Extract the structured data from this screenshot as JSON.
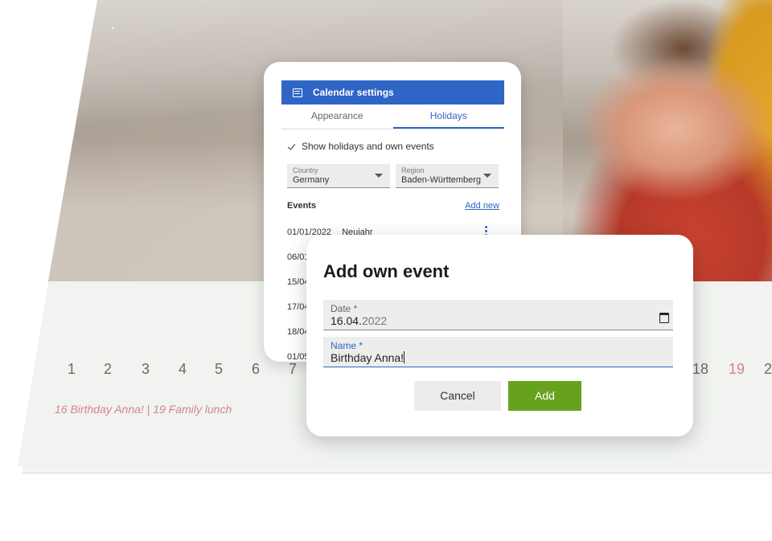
{
  "calendar": {
    "days": [
      {
        "label": "1"
      },
      {
        "label": "2"
      },
      {
        "label": "3"
      },
      {
        "label": "4"
      },
      {
        "label": "5"
      },
      {
        "label": "6"
      },
      {
        "label": "7"
      },
      {
        "label": "18"
      },
      {
        "label": "19",
        "highlight": true
      },
      {
        "label": "2"
      }
    ],
    "event_line": "16  Birthday Anna! | 19  Family lunch"
  },
  "settings": {
    "title": "Calendar settings",
    "icon": "calendar-grid-icon",
    "tabs": [
      {
        "label": "Appearance",
        "active": false
      },
      {
        "label": "Holidays",
        "active": true
      }
    ],
    "show_holidays_label": "Show holidays and own events",
    "show_holidays_checked": true,
    "country": {
      "label": "Country",
      "value": "Germany"
    },
    "region": {
      "label": "Region",
      "value": "Baden-Württemberg"
    },
    "events_title": "Events",
    "add_new_label": "Add new",
    "events": [
      {
        "date": "01/01/2022",
        "name": "Neujahr"
      },
      {
        "date": "06/01",
        "name": ""
      },
      {
        "date": "15/04",
        "name": ""
      },
      {
        "date": "17/04",
        "name": ""
      },
      {
        "date": "18/04",
        "name": ""
      },
      {
        "date": "01/05",
        "name": ""
      }
    ]
  },
  "dialog": {
    "title": "Add own event",
    "date_label": "Date *",
    "date_value_main": "16.04.",
    "date_value_year": "2022",
    "name_label": "Name *",
    "name_value": "Birthday Anna!",
    "cancel_label": "Cancel",
    "add_label": "Add"
  },
  "colors": {
    "accent": "#2f66c5",
    "add_button": "#67a21f",
    "holiday_red": "#d9828d"
  }
}
